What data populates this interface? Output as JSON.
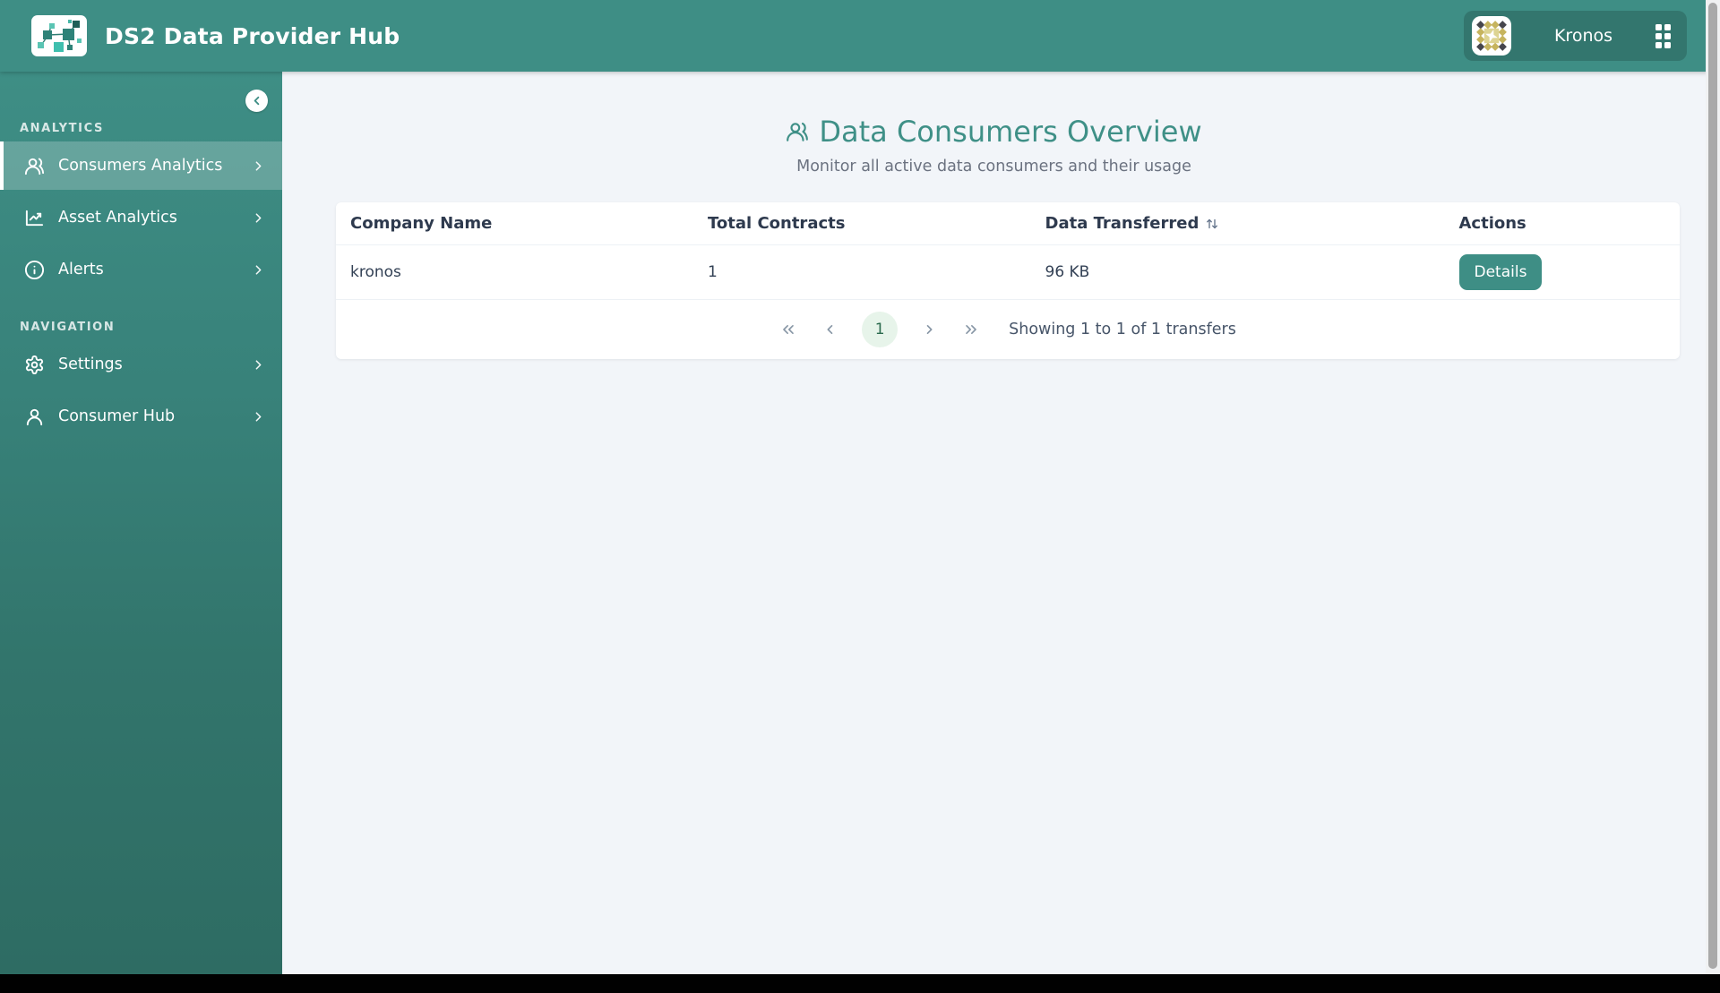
{
  "header": {
    "app_title": "DS2 Data Provider Hub",
    "tenant_name": "Kronos",
    "logo_icon": "network-squares-logo",
    "tenant_avatar_icon": "diamond-pattern-avatar",
    "apps_icon": "grid-dots-icon"
  },
  "sidebar": {
    "collapse_icon": "chevron-left-icon",
    "sections": [
      {
        "label": "ANALYTICS",
        "items": [
          {
            "label": "Consumers Analytics",
            "icon": "users-icon",
            "active": true
          },
          {
            "label": "Asset Analytics",
            "icon": "line-chart-icon",
            "active": false
          },
          {
            "label": "Alerts",
            "icon": "info-circle-icon",
            "active": false
          }
        ]
      },
      {
        "label": "NAVIGATION",
        "items": [
          {
            "label": "Settings",
            "icon": "gear-icon",
            "active": false
          },
          {
            "label": "Consumer Hub",
            "icon": "user-icon",
            "active": false
          }
        ]
      }
    ]
  },
  "main": {
    "title": "Data Consumers Overview",
    "title_icon": "users-icon",
    "subtitle": "Monitor all active data consumers and their usage",
    "table": {
      "columns": [
        "Company Name",
        "Total Contracts",
        "Data Transferred",
        "Actions"
      ],
      "sorted_column": "Data Transferred",
      "sort_icon": "arrows-up-down-icon",
      "rows": [
        {
          "company": "kronos",
          "contracts": "1",
          "transferred": "96 KB",
          "action_label": "Details"
        }
      ]
    },
    "pagination": {
      "first_icon": "chevrons-left-icon",
      "prev_icon": "chevron-left-icon",
      "current_page": "1",
      "next_icon": "chevron-right-icon",
      "last_icon": "chevrons-right-icon",
      "status": "Showing 1 to 1 of 1 transfers"
    }
  },
  "colors": {
    "header_teal": "#3E8E85",
    "sidebar_bottom_teal": "#2E6C63",
    "title_teal": "#3F9087",
    "content_bg": "#F2F5F9",
    "table_header_text": "#2E3A4E",
    "page_badge_bg": "#E7F4EA",
    "page_badge_text": "#2B6A4E",
    "avatar_gold": "#C6B45E",
    "avatar_dark": "#46464D"
  }
}
